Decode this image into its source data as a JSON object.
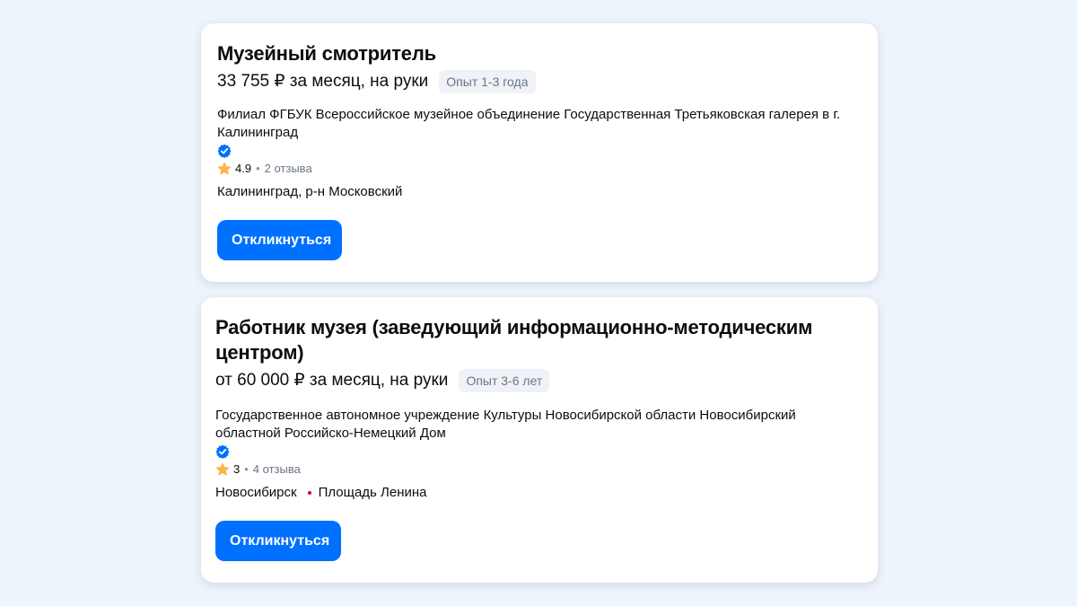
{
  "colors": {
    "background": "#eef4fc",
    "primary_button": "#0070ff",
    "verified": "#0070ff",
    "star": "#ffb44b",
    "metro": "#d6001c",
    "badge_bg": "#eff2f6",
    "muted_text": "#6b7687"
  },
  "vacancies": [
    {
      "title": "Музейный смотритель",
      "salary": "33 755 ₽ за месяц, на руки",
      "experience": "Опыт 1-3 года",
      "company": "Филиал ФГБУК Всероссийское музейное объединение Государственная Третьяковская галерея в г. Калининград",
      "verified_icon": "verified-check-icon",
      "rating": "4.9",
      "reviews": "2 отзыва",
      "location": "Калининград, р-н Московский",
      "apply_label": "Откликнуться"
    },
    {
      "title": "Работник музея (заведующий информационно-методическим центром)",
      "salary": "от 60 000 ₽ за месяц, на руки",
      "experience": "Опыт 3-6 лет",
      "company": "Государственное автономное учреждение Культуры Новосибирской области Новосибирский областной Российско-Немецкий Дом",
      "verified_icon": "verified-check-icon",
      "rating": "3",
      "reviews": "4 отзыва",
      "location": "Новосибирск",
      "metro": "Площадь Ленина",
      "apply_label": "Откликнуться"
    }
  ]
}
